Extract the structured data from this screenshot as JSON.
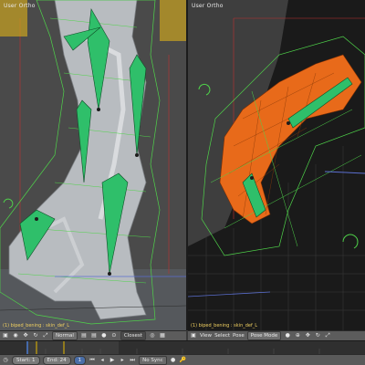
{
  "viewports": {
    "left": {
      "label": "User Ortho",
      "status": "(1) biped_bening : skin_def_L"
    },
    "right": {
      "label": "User Ortho",
      "status": "(1) biped_bening : skin_def_L"
    }
  },
  "left_header": {
    "mode_icon": "object-mode-icon",
    "pivot_label": "Normal",
    "shading_icon": "sphere-shading-icon",
    "snap_label": "Closest",
    "extra_icon": "layers-icon"
  },
  "right_header": {
    "menu_view": "View",
    "menu_select": "Select",
    "menu_pose": "Pose",
    "mode_label": "Pose Mode",
    "shading_icon": "sphere-shading-icon"
  },
  "footer": {
    "start_label": "Start:",
    "start_value": "1",
    "end_label": "End:",
    "end_value": "24",
    "current_frame": "1",
    "sync_label": "No Sync"
  },
  "colors": {
    "bone_green": "#2fbf6a",
    "mesh_orange": "#e86a1a",
    "wire_green": "#4fd34a",
    "timeline_marker": "#e6b800"
  }
}
